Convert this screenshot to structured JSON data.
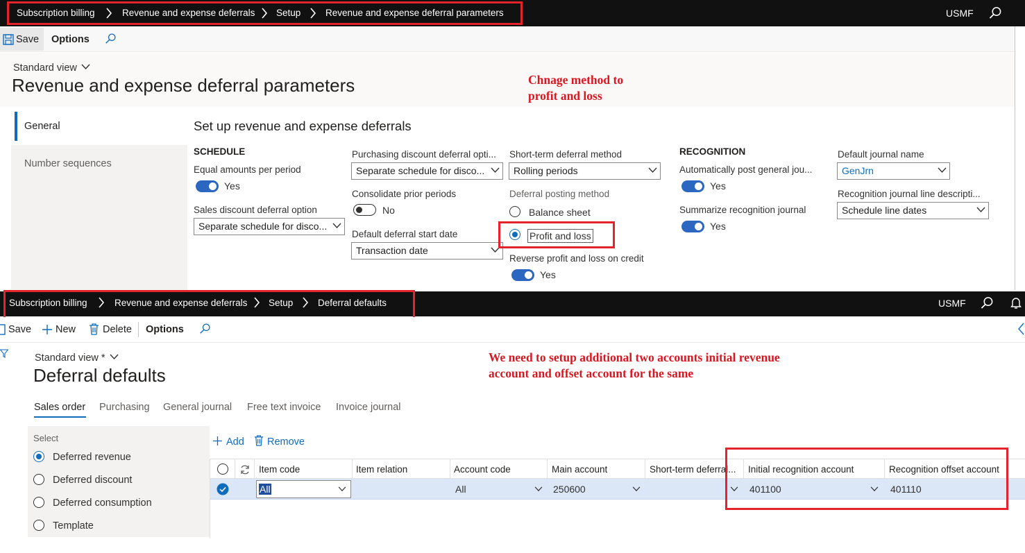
{
  "top": {
    "breadcrumb": [
      "Subscription billing",
      "Revenue and expense deferrals",
      "Setup",
      "Revenue and expense deferral parameters"
    ],
    "company": "USMF",
    "toolbar": {
      "save": "Save",
      "options": "Options"
    },
    "view_name": "Standard view",
    "page_title": "Revenue and expense deferral parameters",
    "annotation": [
      "Chnage method to",
      "profit and loss"
    ],
    "nav": [
      "General",
      "Number sequences"
    ],
    "section_title": "Set up revenue and expense deferrals",
    "schedule": {
      "heading": "SCHEDULE",
      "equal_amounts_label": "Equal amounts per period",
      "equal_amounts_value": "Yes",
      "sales_discount_label": "Sales discount deferral option",
      "sales_discount_value": "Separate schedule for disco..."
    },
    "col2": {
      "purchasing_label": "Purchasing discount deferral opti...",
      "purchasing_value": "Separate schedule for disco...",
      "consolidate_label": "Consolidate prior periods",
      "consolidate_value": "No",
      "start_date_label": "Default deferral start date",
      "start_date_value": "Transaction date"
    },
    "col3": {
      "short_term_label": "Short-term deferral method",
      "short_term_value": "Rolling periods",
      "posting_label": "Deferral posting method",
      "posting_opt1": "Balance sheet",
      "posting_opt2": "Profit and loss",
      "reverse_label": "Reverse profit and loss on credit",
      "reverse_value": "Yes"
    },
    "recognition": {
      "heading": "RECOGNITION",
      "auto_post_label": "Automatically post general jou...",
      "auto_post_value": "Yes",
      "summarize_label": "Summarize recognition journal",
      "summarize_value": "Yes"
    },
    "col5": {
      "journal_label": "Default journal name",
      "journal_value": "GenJrn",
      "line_desc_label": "Recognition journal line descripti...",
      "line_desc_value": "Schedule line dates"
    }
  },
  "bottom": {
    "breadcrumb": [
      "Subscription billing",
      "Revenue and expense deferrals",
      "Setup",
      "Deferral defaults"
    ],
    "company": "USMF",
    "toolbar": {
      "save": "Save",
      "new": "New",
      "delete": "Delete",
      "options": "Options"
    },
    "view_name": "Standard view *",
    "page_title": "Deferral defaults",
    "annotation": [
      "We need to setup additional two accounts initial revenue",
      "account and offset account for the same"
    ],
    "tabs": [
      "Sales order",
      "Purchasing",
      "General journal",
      "Free text invoice",
      "Invoice journal"
    ],
    "select_label": "Select",
    "select_options": [
      "Deferred revenue",
      "Deferred discount",
      "Deferred consumption",
      "Template"
    ],
    "grid_actions": {
      "add": "Add",
      "remove": "Remove"
    },
    "columns": [
      "Item code",
      "Item relation",
      "Account code",
      "Main account",
      "Short-term deferral...",
      "Initial recognition account",
      "Recognition offset account"
    ],
    "row": {
      "item_code": "All",
      "item_relation": "",
      "account_code": "All",
      "main_account": "250600",
      "short_term": "",
      "initial_recognition": "401100",
      "recognition_offset": "401110"
    }
  },
  "colors": {
    "annotation_red": "#e3242b",
    "accent_blue": "#0f6cbd",
    "nav_bg": "#111111"
  }
}
